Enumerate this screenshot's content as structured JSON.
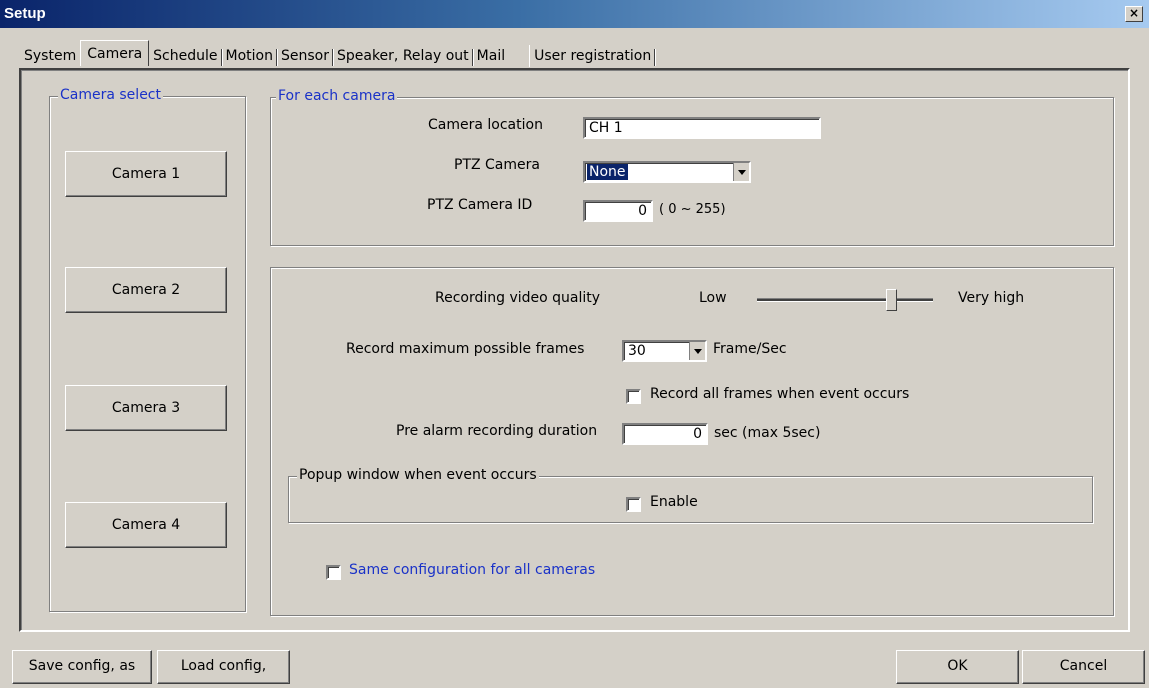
{
  "window": {
    "title": "Setup",
    "close_glyph": "×"
  },
  "tabs": [
    {
      "label": "System"
    },
    {
      "label": "Camera"
    },
    {
      "label": "Schedule"
    },
    {
      "label": "Motion"
    },
    {
      "label": "Sensor"
    },
    {
      "label": "Speaker, Relay out"
    },
    {
      "label": "Mail"
    },
    {
      "label": "User registration"
    }
  ],
  "active_tab": "Camera",
  "camera_select": {
    "legend": "Camera select",
    "buttons": [
      "Camera 1",
      "Camera 2",
      "Camera 3",
      "Camera 4"
    ]
  },
  "for_each_camera": {
    "legend": "For each camera",
    "location_label": "Camera location",
    "location_value": "CH 1",
    "ptz_label": "PTZ Camera",
    "ptz_value": "None",
    "ptz_id_label": "PTZ Camera ID",
    "ptz_id_value": "0",
    "ptz_id_range": "( 0 ~ 255)"
  },
  "recording": {
    "quality_label": "Recording video quality",
    "quality_low": "Low",
    "quality_high": "Very high",
    "quality_level": 0.78,
    "max_frames_label": "Record maximum possible frames",
    "max_frames_value": "30",
    "frames_unit": "Frame/Sec",
    "record_all_label": "Record all frames when event occurs",
    "record_all_checked": false,
    "pre_alarm_label": "Pre alarm recording duration",
    "pre_alarm_value": "0",
    "pre_alarm_unit": "sec (max 5sec)"
  },
  "popup": {
    "legend": "Popup window when event occurs",
    "enable_label": "Enable",
    "enable_checked": false
  },
  "same_config_label": "Same configuration for all cameras",
  "footer": {
    "save_label": "Save config, as",
    "load_label": "Load config,",
    "ok_label": "OK",
    "cancel_label": "Cancel"
  },
  "colors": {
    "accent_blue": "#1a32c8",
    "title_gradient_start": "#0a246a",
    "dialog_bg": "#d4d0c8"
  }
}
